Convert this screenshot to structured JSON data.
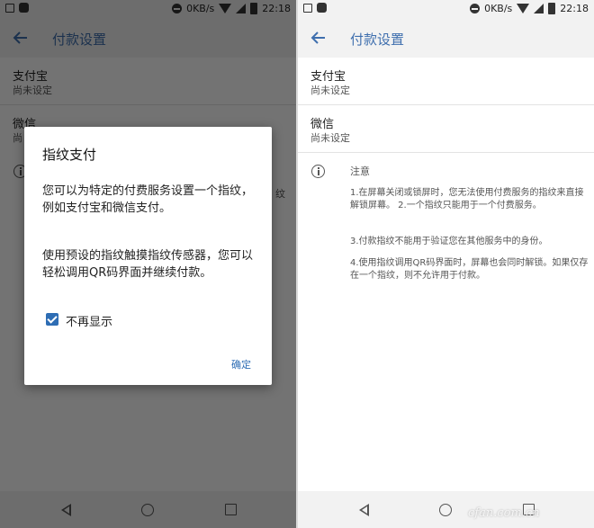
{
  "status_bar": {
    "speed": "0KB/s",
    "time": "22:18"
  },
  "app_bar": {
    "title": "付款设置"
  },
  "settings": {
    "items": [
      {
        "title": "支付宝",
        "subtitle": "尚未设定"
      },
      {
        "title": "微信",
        "subtitle": "尚未设定"
      }
    ]
  },
  "note": {
    "heading": "注意",
    "paragraphs": [
      "1.在屏幕关闭或锁屏时，您无法使用付费服务的指纹来直接解锁屏幕。 2.一个指纹只能用于一个付费服务。",
      "3.付款指纹不能用于验证您在其他服务中的身份。",
      "4.使用指纹调用QR码界面时，屏幕也会同时解锁。如果仅存在一个指纹，则不允许用于付款。"
    ]
  },
  "dialog": {
    "title": "指纹支付",
    "message_1": "您可以为特定的付费服务设置一个指纹，例如支付宝和微信支付。",
    "message_2": "使用预设的指纹触摸指纹传感器，您可以轻松调用QR码界面并继续付款。",
    "checkbox_label": "不再显示",
    "checkbox_checked": true,
    "confirm_label": "确定"
  },
  "left_partial": {
    "subtitle_fragment": "尚",
    "note_fragment": "纹"
  },
  "watermark": "cfan.com.cn",
  "colors": {
    "accent": "#2e6db4",
    "title_blue": "#3f6fae",
    "scrim": "rgba(0,0,0,0.55)"
  }
}
